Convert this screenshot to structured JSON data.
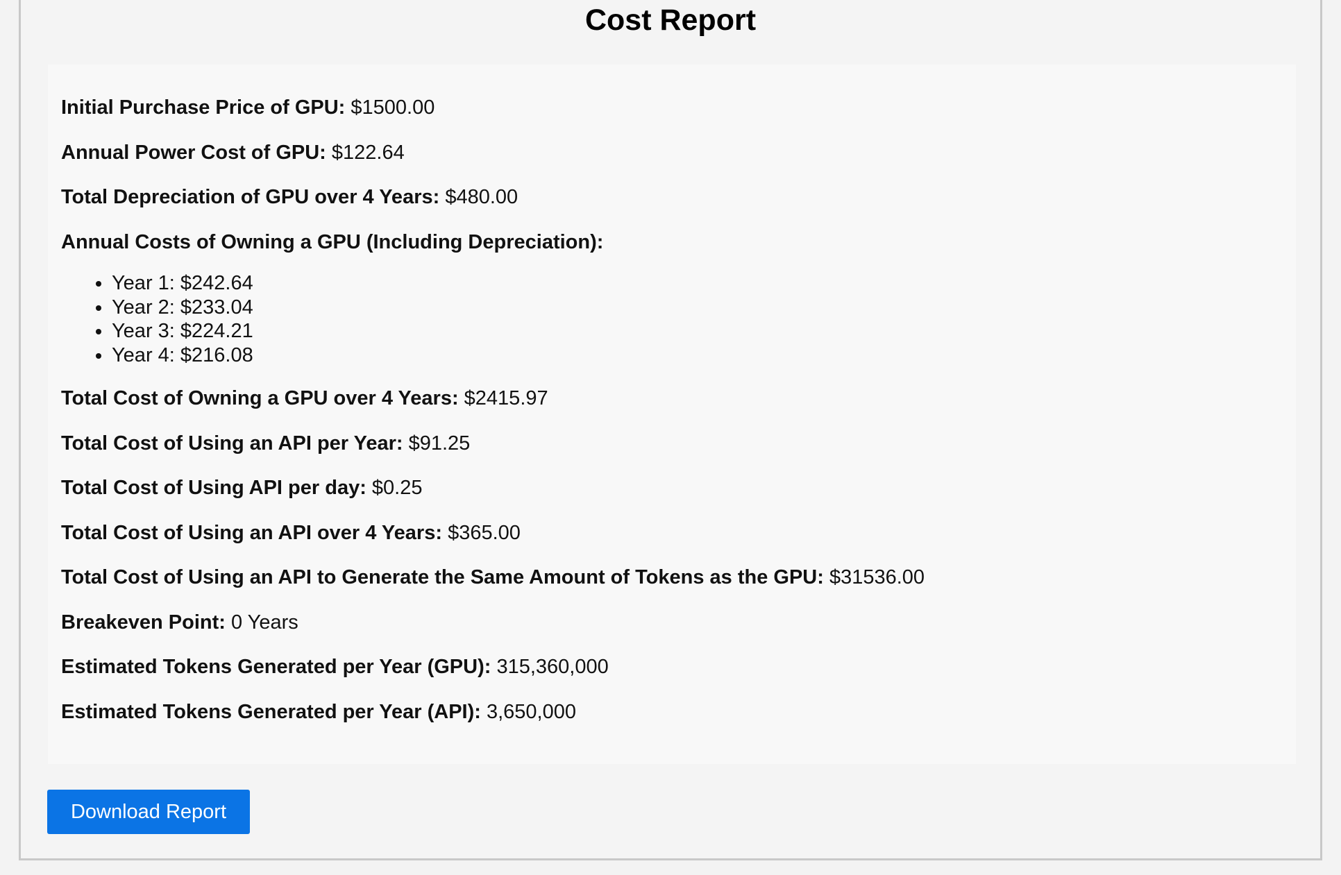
{
  "report": {
    "title": "Cost Report",
    "rows_before_list": [
      {
        "label": "Initial Purchase Price of GPU:",
        "value": "$1500.00"
      },
      {
        "label": "Annual Power Cost of GPU:",
        "value": "$122.64"
      },
      {
        "label": "Total Depreciation of GPU over 4 Years:",
        "value": "$480.00"
      },
      {
        "label": "Annual Costs of Owning a GPU (Including Depreciation):",
        "value": ""
      }
    ],
    "annual_costs": [
      "Year 1: $242.64",
      "Year 2: $233.04",
      "Year 3: $224.21",
      "Year 4: $216.08"
    ],
    "rows_after_list": [
      {
        "label": "Total Cost of Owning a GPU over 4 Years:",
        "value": "$2415.97"
      },
      {
        "label": "Total Cost of Using an API per Year:",
        "value": "$91.25"
      },
      {
        "label": "Total Cost of Using API per day:",
        "value": "$0.25"
      },
      {
        "label": "Total Cost of Using an API over 4 Years:",
        "value": "$365.00"
      },
      {
        "label": "Total Cost of Using an API to Generate the Same Amount of Tokens as the GPU:",
        "value": "$31536.00"
      },
      {
        "label": "Breakeven Point:",
        "value": "0 Years"
      },
      {
        "label": "Estimated Tokens Generated per Year (GPU):",
        "value": "315,360,000"
      },
      {
        "label": "Estimated Tokens Generated per Year (API):",
        "value": "3,650,000"
      }
    ]
  },
  "actions": {
    "download_label": "Download Report"
  },
  "colors": {
    "button_bg": "#0b74e5",
    "button_text": "#ffffff",
    "panel_bg": "#f8f8f8",
    "page_bg": "#f4f4f4"
  }
}
